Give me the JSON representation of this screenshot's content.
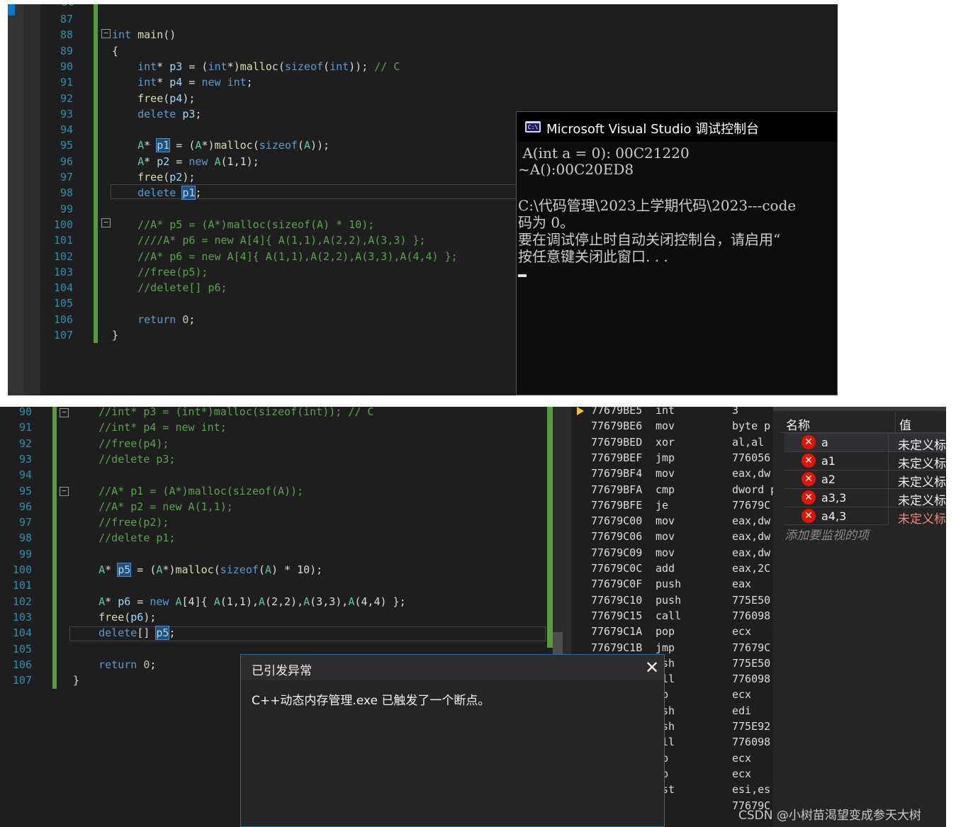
{
  "top_editor": {
    "lines": [
      {
        "n": "87",
        "html": ""
      },
      {
        "n": "88",
        "html": "<span class='kw'>int</span> <span class='fn'>main</span><span class='tx'>()</span>"
      },
      {
        "n": "89",
        "html": "<span class='tx'>{</span>"
      },
      {
        "n": "90",
        "html": "    <span class='kw'>int</span><span class='tx'>* </span><span class='id'>p3</span><span class='tx'> = (</span><span class='kw'>int</span><span class='tx'>*)</span><span class='fn'>malloc</span><span class='tx'>(</span><span class='kw'>sizeof</span><span class='tx'>(</span><span class='kw'>int</span><span class='tx'>)); </span><span class='cm'>// C</span>"
      },
      {
        "n": "91",
        "html": "    <span class='kw'>int</span><span class='tx'>* </span><span class='id'>p4</span><span class='tx'> = </span><span class='kw'>new</span> <span class='kw'>int</span><span class='tx'>;</span>"
      },
      {
        "n": "92",
        "html": "    <span class='fn'>free</span><span class='tx'>(</span><span class='id'>p4</span><span class='tx'>);</span>"
      },
      {
        "n": "93",
        "html": "    <span class='kw'>delete</span> <span class='id'>p3</span><span class='tx'>;</span>"
      },
      {
        "n": "94",
        "html": ""
      },
      {
        "n": "95",
        "html": "    <span class='ty'>A</span><span class='tx'>* </span><span class='id hl'>p1</span><span class='tx'> = (</span><span class='ty'>A</span><span class='tx'>*)</span><span class='fn'>malloc</span><span class='tx'>(</span><span class='kw'>sizeof</span><span class='tx'>(</span><span class='ty'>A</span><span class='tx'>));</span>"
      },
      {
        "n": "96",
        "html": "    <span class='ty'>A</span><span class='tx'>* </span><span class='id'>p2</span><span class='tx'> = </span><span class='kw'>new</span> <span class='ty'>A</span><span class='tx'>(1,1);</span>"
      },
      {
        "n": "97",
        "html": "    <span class='fn'>free</span><span class='tx'>(</span><span class='id'>p2</span><span class='tx'>);</span>"
      },
      {
        "n": "98",
        "html": "    <span class='kw'>delete</span> <span class='id hl'>p1</span><span class='tx'>;</span>"
      },
      {
        "n": "99",
        "html": ""
      },
      {
        "n": "100",
        "html": "    <span class='cm'>//A* p5 = (A*)malloc(sizeof(A) * 10);</span>"
      },
      {
        "n": "101",
        "html": "    <span class='cm'>////A* p6 = new A[4]{ A(1,1),A(2,2),A(3,3) };</span>"
      },
      {
        "n": "102",
        "html": "    <span class='cm'>//A* p6 = new A[4]{ A(1,1),A(2,2),A(3,3),A(4,4) };</span>"
      },
      {
        "n": "103",
        "html": "    <span class='cm'>//free(p5);</span>"
      },
      {
        "n": "104",
        "html": "    <span class='cm'>//delete[] p6;</span>"
      },
      {
        "n": "105",
        "html": ""
      },
      {
        "n": "106",
        "html": "    <span class='kw'>return</span> <span class='num'>0</span><span class='tx'>;</span>"
      },
      {
        "n": "107",
        "html": "<span class='tx'>}</span>"
      }
    ]
  },
  "console": {
    "title": "Microsoft Visual Studio 调试控制台",
    "icon": "console-app-icon",
    "lines": [
      " A(int a = 0): 00C21220",
      "~A():00C20ED8",
      "",
      "C:\\代码管理\\2023上学期代码\\2023---code",
      "码为 0。",
      "要在调试停止时自动关闭控制台，请启用“",
      "按任意键关闭此窗口. . ."
    ]
  },
  "bottom_editor": {
    "lines": [
      {
        "n": "90",
        "html": "    <span class='cm'>//int* p3 = (int*)malloc(sizeof(int)); // C</span>"
      },
      {
        "n": "91",
        "html": "    <span class='cm'>//int* p4 = new int;</span>"
      },
      {
        "n": "92",
        "html": "    <span class='cm'>//free(p4);</span>"
      },
      {
        "n": "93",
        "html": "    <span class='cm'>//delete p3;</span>"
      },
      {
        "n": "94",
        "html": ""
      },
      {
        "n": "95",
        "html": "    <span class='cm'>//A* p1 = (A*)malloc(sizeof(A));</span>"
      },
      {
        "n": "96",
        "html": "    <span class='cm'>//A* p2 = new A(1,1);</span>"
      },
      {
        "n": "97",
        "html": "    <span class='cm'>//free(p2);</span>"
      },
      {
        "n": "98",
        "html": "    <span class='cm'>//delete p1;</span>"
      },
      {
        "n": "99",
        "html": ""
      },
      {
        "n": "100",
        "html": "    <span class='ty'>A</span><span class='tx'>* </span><span class='id hl'>p5</span><span class='tx'> = (</span><span class='ty'>A</span><span class='tx'>*)</span><span class='fn'>malloc</span><span class='tx'>(</span><span class='kw'>sizeof</span><span class='tx'>(</span><span class='ty'>A</span><span class='tx'>) * 10);</span>"
      },
      {
        "n": "101",
        "html": ""
      },
      {
        "n": "102",
        "html": "    <span class='ty'>A</span><span class='tx'>* </span><span class='id'>p6</span><span class='tx'> = </span><span class='kw'>new</span> <span class='ty'>A</span><span class='tx'>[4]{ </span><span class='ty'>A</span><span class='tx'>(1,1),</span><span class='ty'>A</span><span class='tx'>(2,2),</span><span class='ty'>A</span><span class='tx'>(3,3),</span><span class='ty'>A</span><span class='tx'>(4,4) };</span>"
      },
      {
        "n": "103",
        "html": "    <span class='fn'>free</span><span class='tx'>(</span><span class='id'>p6</span><span class='tx'>);</span>"
      },
      {
        "n": "104",
        "html": "    <span class='kw'>delete</span><span class='tx'>[] </span><span class='id hl'>p5</span><span class='tx'>;</span>"
      },
      {
        "n": "105",
        "html": ""
      },
      {
        "n": "106",
        "html": "    <span class='kw'>return</span> <span class='num'>0</span><span class='tx'>;</span>"
      },
      {
        "n": "107",
        "html": "<span class='tx'>}</span>"
      }
    ]
  },
  "disassembly": {
    "rows": [
      {
        "addr": "77679BE5",
        "op": "int",
        "arg": "3"
      },
      {
        "addr": "77679BE6",
        "op": "mov",
        "arg": "byte p"
      },
      {
        "addr": "77679BED",
        "op": "xor",
        "arg": "al,al"
      },
      {
        "addr": "77679BEF",
        "op": "jmp",
        "arg": "776056"
      },
      {
        "addr": "77679BF4",
        "op": "mov",
        "arg": "eax,dw"
      },
      {
        "addr": "77679BFA",
        "op": "cmp",
        "arg": "dword p"
      },
      {
        "addr": "77679BFE",
        "op": "je",
        "arg": "77679C"
      },
      {
        "addr": "77679C00",
        "op": "mov",
        "arg": "eax,dw"
      },
      {
        "addr": "77679C06",
        "op": "mov",
        "arg": "eax,dw"
      },
      {
        "addr": "77679C09",
        "op": "mov",
        "arg": "eax,dw"
      },
      {
        "addr": "77679C0C",
        "op": "add",
        "arg": "eax,2C"
      },
      {
        "addr": "77679C0F",
        "op": "push",
        "arg": "eax"
      },
      {
        "addr": "77679C10",
        "op": "push",
        "arg": "775E50"
      },
      {
        "addr": "77679C15",
        "op": "call",
        "arg": "776098"
      },
      {
        "addr": "77679C1A",
        "op": "pop",
        "arg": "ecx"
      },
      {
        "addr": "77679C1B",
        "op": "jmp",
        "arg": "77679C"
      },
      {
        "addr": "",
        "op": "ush",
        "arg": "775E50"
      },
      {
        "addr": "",
        "op": "all",
        "arg": "776098"
      },
      {
        "addr": "",
        "op": "op",
        "arg": "ecx"
      },
      {
        "addr": "",
        "op": "ush",
        "arg": "edi"
      },
      {
        "addr": "",
        "op": "ush",
        "arg": "775E92"
      },
      {
        "addr": "",
        "op": "all",
        "arg": "776098"
      },
      {
        "addr": "",
        "op": "op",
        "arg": "ecx"
      },
      {
        "addr": "",
        "op": "op",
        "arg": "ecx"
      },
      {
        "addr": "",
        "op": "est",
        "arg": "esi,es"
      },
      {
        "addr": "",
        "op": "e",
        "arg": "77679C"
      }
    ]
  },
  "watch": {
    "col_name": "名称",
    "col_value": "值",
    "rows": [
      {
        "name": "a",
        "value": "未定义标"
      },
      {
        "name": "a1",
        "value": "未定义标"
      },
      {
        "name": "a2",
        "value": "未定义标"
      },
      {
        "name": "a3,3",
        "value": "未定义标"
      },
      {
        "name": "a4,3",
        "value": "未定义标"
      }
    ],
    "add_placeholder": "添加要监视的项"
  },
  "exception": {
    "title": "已引发异常",
    "message": "C++动态内存管理.exe 已触发了一个断点。"
  },
  "watermark": "CSDN @小树苗渴望变成参天大树"
}
